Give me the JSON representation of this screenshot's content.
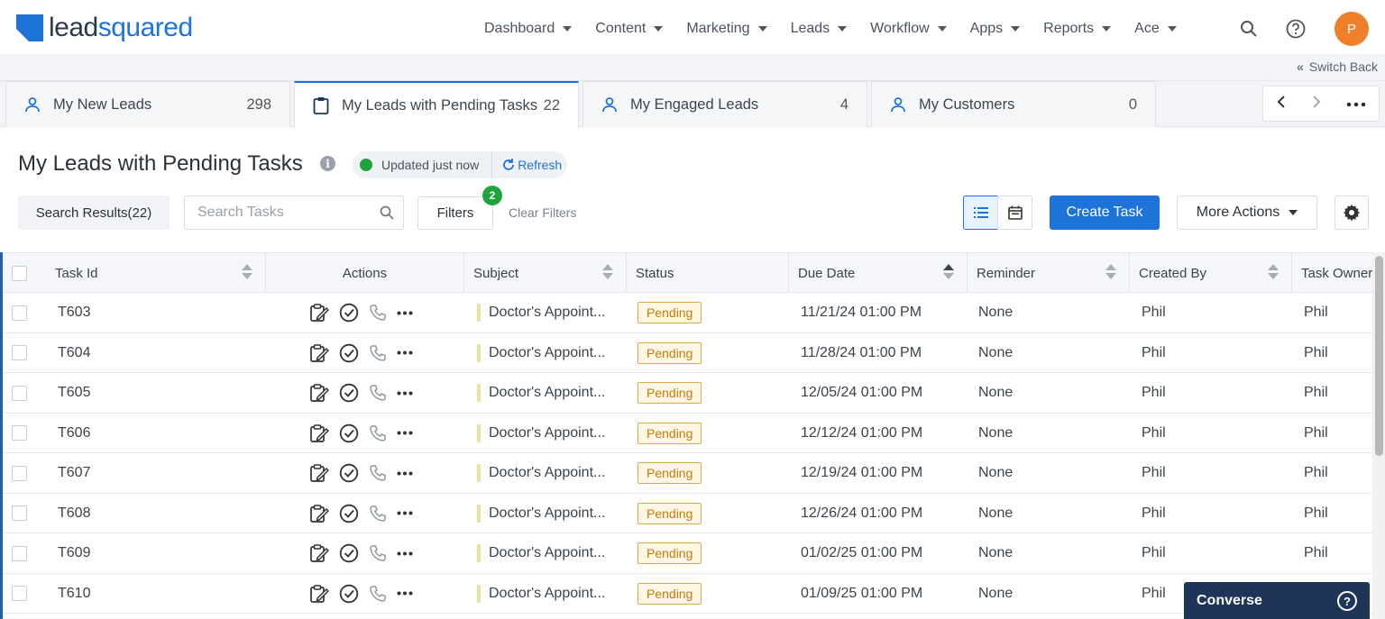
{
  "brand": {
    "logo_text_dark": "lead",
    "logo_text_blue": "squared"
  },
  "nav": {
    "items": [
      {
        "label": "Dashboard"
      },
      {
        "label": "Content"
      },
      {
        "label": "Marketing"
      },
      {
        "label": "Leads"
      },
      {
        "label": "Workflow"
      },
      {
        "label": "Apps"
      },
      {
        "label": "Reports"
      },
      {
        "label": "Ace"
      }
    ],
    "avatar_initial": "P"
  },
  "switch_back": "Switch Back",
  "tabs": [
    {
      "label": "My New Leads",
      "count": "298",
      "icon": "user-icon"
    },
    {
      "label": "My Leads with Pending Tasks",
      "count": "22",
      "icon": "clipboard-icon"
    },
    {
      "label": "My Engaged Leads",
      "count": "4",
      "icon": "user-icon"
    },
    {
      "label": "My Customers",
      "count": "0",
      "icon": "user-icon"
    }
  ],
  "page": {
    "title": "My Leads with Pending Tasks",
    "updated_text": "Updated just now",
    "refresh_label": "Refresh"
  },
  "toolbar": {
    "search_results": "Search Results(22)",
    "search_placeholder": "Search Tasks",
    "filters_label": "Filters",
    "filters_count": "2",
    "clear_filters": "Clear Filters",
    "create_task": "Create Task",
    "more_actions": "More Actions"
  },
  "table": {
    "columns": {
      "task_id": "Task Id",
      "actions": "Actions",
      "subject": "Subject",
      "status": "Status",
      "due_date": "Due Date",
      "reminder": "Reminder",
      "created_by": "Created By",
      "task_owner": "Task Owner"
    },
    "rows": [
      {
        "id": "T603",
        "subject": "Doctor's Appoint...",
        "status": "Pending",
        "due": "11/21/24 01:00 PM",
        "reminder": "None",
        "created_by": "Phil",
        "owner": "Phil"
      },
      {
        "id": "T604",
        "subject": "Doctor's Appoint...",
        "status": "Pending",
        "due": "11/28/24 01:00 PM",
        "reminder": "None",
        "created_by": "Phil",
        "owner": "Phil"
      },
      {
        "id": "T605",
        "subject": "Doctor's Appoint...",
        "status": "Pending",
        "due": "12/05/24 01:00 PM",
        "reminder": "None",
        "created_by": "Phil",
        "owner": "Phil"
      },
      {
        "id": "T606",
        "subject": "Doctor's Appoint...",
        "status": "Pending",
        "due": "12/12/24 01:00 PM",
        "reminder": "None",
        "created_by": "Phil",
        "owner": "Phil"
      },
      {
        "id": "T607",
        "subject": "Doctor's Appoint...",
        "status": "Pending",
        "due": "12/19/24 01:00 PM",
        "reminder": "None",
        "created_by": "Phil",
        "owner": "Phil"
      },
      {
        "id": "T608",
        "subject": "Doctor's Appoint...",
        "status": "Pending",
        "due": "12/26/24 01:00 PM",
        "reminder": "None",
        "created_by": "Phil",
        "owner": "Phil"
      },
      {
        "id": "T609",
        "subject": "Doctor's Appoint...",
        "status": "Pending",
        "due": "01/02/25 01:00 PM",
        "reminder": "None",
        "created_by": "Phil",
        "owner": "Phil"
      },
      {
        "id": "T610",
        "subject": "Doctor's Appoint...",
        "status": "Pending",
        "due": "01/09/25 01:00 PM",
        "reminder": "None",
        "created_by": "Phil",
        "owner": ""
      }
    ]
  },
  "converse": {
    "label": "Converse"
  },
  "colors": {
    "accent": "#1e73d8",
    "success": "#1fa33d",
    "pending": "#c17d0b",
    "avatar": "#ef7f2b"
  }
}
